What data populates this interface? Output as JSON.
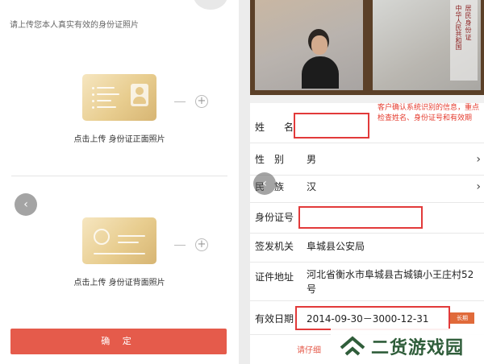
{
  "left": {
    "hint": "请上传您本人真实有效的身份证照片",
    "front_caption": "点击上传 身份证正面照片",
    "back_caption": "点击上传 身份证背面照片",
    "plus_symbol": "+",
    "nav_icon": "chevron-left-icon",
    "confirm_label": "确 定"
  },
  "right": {
    "note": "客户确认系统识别的信息，重点检查姓名、身份证号和有效期",
    "rows": [
      {
        "label": "姓　　名",
        "value": ""
      },
      {
        "label": "性　别",
        "value": "男"
      },
      {
        "label": "民　族",
        "value": "汉"
      },
      {
        "label": "身份证号",
        "value": ""
      },
      {
        "label": "签发机关",
        "value": "阜城县公安局"
      },
      {
        "label": "证件地址",
        "value": "河北省衡水市阜城县古城镇小王庄村52号"
      },
      {
        "label": "有效日期",
        "value": "2014-09-30－3000-12-31"
      }
    ],
    "chevron": "›",
    "badge": "长期",
    "bottom_note": "请仔细",
    "id_back_text_1": "中华人民共和国",
    "id_back_text_2": "居民身份证"
  },
  "watermark": {
    "text": "二货游戏园"
  },
  "colors": {
    "accent": "#e55b4b",
    "highlight_box": "#e23a3a",
    "watermark": "#2f5d3a"
  }
}
